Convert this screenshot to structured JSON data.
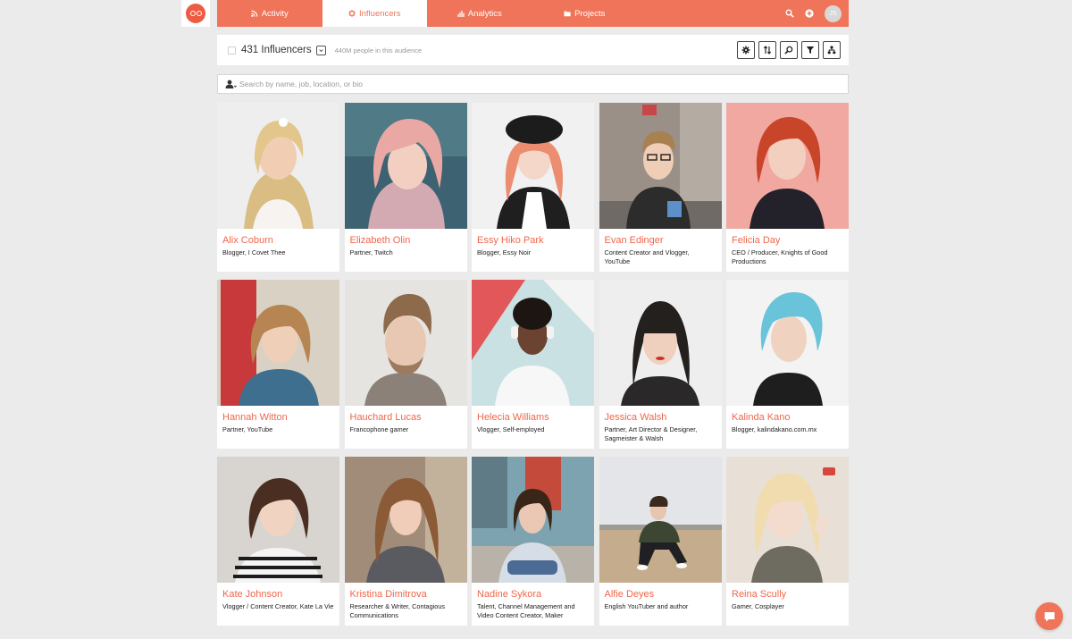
{
  "app": {
    "audience_count": "431 Influencers",
    "audience_people": "440M people in this audience",
    "user_initials": "JS"
  },
  "nav": {
    "tabs": [
      {
        "label": "Activity",
        "icon": "rss-icon"
      },
      {
        "label": "Influencers",
        "icon": "gear-icon",
        "active": true
      },
      {
        "label": "Analytics",
        "icon": "bar-chart-icon"
      },
      {
        "label": "Projects",
        "icon": "folder-icon"
      }
    ]
  },
  "search": {
    "placeholder": "Search by name, job, location, or bio",
    "value": ""
  },
  "toolbar": [
    "settings-icon",
    "sort-icon",
    "search-icon",
    "filter-icon",
    "hierarchy-icon"
  ],
  "colors": {
    "accent": "#f07459",
    "name_text": "#f0664b",
    "page_background": "#ebebeb"
  },
  "influencers": [
    {
      "name": "Alix Coburn",
      "role": "Blogger, I Covet Thee"
    },
    {
      "name": "Elizabeth Olin",
      "role": "Partner, Twitch"
    },
    {
      "name": "Essy Hiko Park",
      "role": "Blogger, Essy Noir"
    },
    {
      "name": "Evan Edinger",
      "role": "Content Creator and Vlogger, YouTube"
    },
    {
      "name": "Felicia Day",
      "role": "CEO / Producer, Knights of Good Productions"
    },
    {
      "name": "Hannah Witton",
      "role": "Partner, YouTube"
    },
    {
      "name": "Hauchard Lucas",
      "role": "Francophone gamer"
    },
    {
      "name": "Helecia Williams",
      "role": "Vlogger, Self-employed"
    },
    {
      "name": "Jessica Walsh",
      "role": "Partner, Art Director & Designer, Sagmeister & Walsh"
    },
    {
      "name": "Kalinda Kano",
      "role": "Blogger, kalindakano.com.mx"
    },
    {
      "name": "Kate Johnson",
      "role": "Vlogger / Content Creator, Kate La Vie"
    },
    {
      "name": "Kristina Dimitrova",
      "role": "Researcher & Writer, Contagious Communications"
    },
    {
      "name": "Nadine Sykora",
      "role": "Talent, Channel Management and Video Content Creator, Maker"
    },
    {
      "name": "Alfie Deyes",
      "role": "English YouTuber and author"
    },
    {
      "name": "Reina Scully",
      "role": "Gamer, Cosplayer"
    }
  ]
}
